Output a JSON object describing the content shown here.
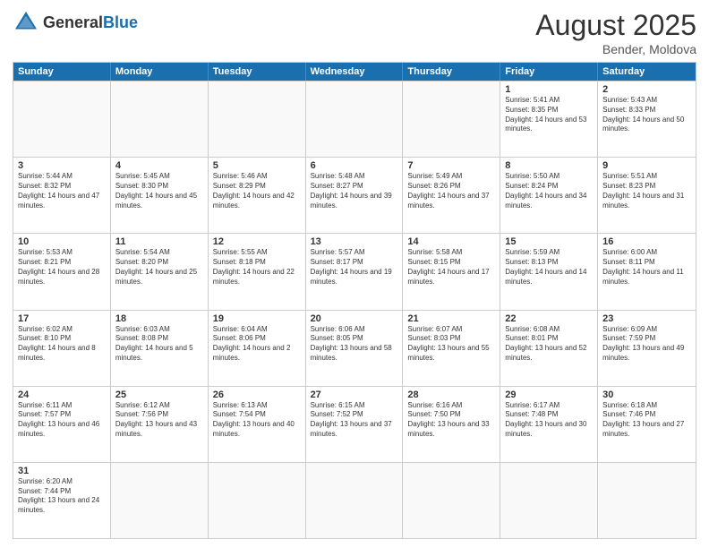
{
  "header": {
    "logo_general": "General",
    "logo_blue": "Blue",
    "month_title": "August 2025",
    "location": "Bender, Moldova"
  },
  "weekdays": [
    "Sunday",
    "Monday",
    "Tuesday",
    "Wednesday",
    "Thursday",
    "Friday",
    "Saturday"
  ],
  "rows": [
    [
      {
        "day": "",
        "info": ""
      },
      {
        "day": "",
        "info": ""
      },
      {
        "day": "",
        "info": ""
      },
      {
        "day": "",
        "info": ""
      },
      {
        "day": "",
        "info": ""
      },
      {
        "day": "1",
        "info": "Sunrise: 5:41 AM\nSunset: 8:35 PM\nDaylight: 14 hours and 53 minutes."
      },
      {
        "day": "2",
        "info": "Sunrise: 5:43 AM\nSunset: 8:33 PM\nDaylight: 14 hours and 50 minutes."
      }
    ],
    [
      {
        "day": "3",
        "info": "Sunrise: 5:44 AM\nSunset: 8:32 PM\nDaylight: 14 hours and 47 minutes."
      },
      {
        "day": "4",
        "info": "Sunrise: 5:45 AM\nSunset: 8:30 PM\nDaylight: 14 hours and 45 minutes."
      },
      {
        "day": "5",
        "info": "Sunrise: 5:46 AM\nSunset: 8:29 PM\nDaylight: 14 hours and 42 minutes."
      },
      {
        "day": "6",
        "info": "Sunrise: 5:48 AM\nSunset: 8:27 PM\nDaylight: 14 hours and 39 minutes."
      },
      {
        "day": "7",
        "info": "Sunrise: 5:49 AM\nSunset: 8:26 PM\nDaylight: 14 hours and 37 minutes."
      },
      {
        "day": "8",
        "info": "Sunrise: 5:50 AM\nSunset: 8:24 PM\nDaylight: 14 hours and 34 minutes."
      },
      {
        "day": "9",
        "info": "Sunrise: 5:51 AM\nSunset: 8:23 PM\nDaylight: 14 hours and 31 minutes."
      }
    ],
    [
      {
        "day": "10",
        "info": "Sunrise: 5:53 AM\nSunset: 8:21 PM\nDaylight: 14 hours and 28 minutes."
      },
      {
        "day": "11",
        "info": "Sunrise: 5:54 AM\nSunset: 8:20 PM\nDaylight: 14 hours and 25 minutes."
      },
      {
        "day": "12",
        "info": "Sunrise: 5:55 AM\nSunset: 8:18 PM\nDaylight: 14 hours and 22 minutes."
      },
      {
        "day": "13",
        "info": "Sunrise: 5:57 AM\nSunset: 8:17 PM\nDaylight: 14 hours and 19 minutes."
      },
      {
        "day": "14",
        "info": "Sunrise: 5:58 AM\nSunset: 8:15 PM\nDaylight: 14 hours and 17 minutes."
      },
      {
        "day": "15",
        "info": "Sunrise: 5:59 AM\nSunset: 8:13 PM\nDaylight: 14 hours and 14 minutes."
      },
      {
        "day": "16",
        "info": "Sunrise: 6:00 AM\nSunset: 8:11 PM\nDaylight: 14 hours and 11 minutes."
      }
    ],
    [
      {
        "day": "17",
        "info": "Sunrise: 6:02 AM\nSunset: 8:10 PM\nDaylight: 14 hours and 8 minutes."
      },
      {
        "day": "18",
        "info": "Sunrise: 6:03 AM\nSunset: 8:08 PM\nDaylight: 14 hours and 5 minutes."
      },
      {
        "day": "19",
        "info": "Sunrise: 6:04 AM\nSunset: 8:06 PM\nDaylight: 14 hours and 2 minutes."
      },
      {
        "day": "20",
        "info": "Sunrise: 6:06 AM\nSunset: 8:05 PM\nDaylight: 13 hours and 58 minutes."
      },
      {
        "day": "21",
        "info": "Sunrise: 6:07 AM\nSunset: 8:03 PM\nDaylight: 13 hours and 55 minutes."
      },
      {
        "day": "22",
        "info": "Sunrise: 6:08 AM\nSunset: 8:01 PM\nDaylight: 13 hours and 52 minutes."
      },
      {
        "day": "23",
        "info": "Sunrise: 6:09 AM\nSunset: 7:59 PM\nDaylight: 13 hours and 49 minutes."
      }
    ],
    [
      {
        "day": "24",
        "info": "Sunrise: 6:11 AM\nSunset: 7:57 PM\nDaylight: 13 hours and 46 minutes."
      },
      {
        "day": "25",
        "info": "Sunrise: 6:12 AM\nSunset: 7:56 PM\nDaylight: 13 hours and 43 minutes."
      },
      {
        "day": "26",
        "info": "Sunrise: 6:13 AM\nSunset: 7:54 PM\nDaylight: 13 hours and 40 minutes."
      },
      {
        "day": "27",
        "info": "Sunrise: 6:15 AM\nSunset: 7:52 PM\nDaylight: 13 hours and 37 minutes."
      },
      {
        "day": "28",
        "info": "Sunrise: 6:16 AM\nSunset: 7:50 PM\nDaylight: 13 hours and 33 minutes."
      },
      {
        "day": "29",
        "info": "Sunrise: 6:17 AM\nSunset: 7:48 PM\nDaylight: 13 hours and 30 minutes."
      },
      {
        "day": "30",
        "info": "Sunrise: 6:18 AM\nSunset: 7:46 PM\nDaylight: 13 hours and 27 minutes."
      }
    ],
    [
      {
        "day": "31",
        "info": "Sunrise: 6:20 AM\nSunset: 7:44 PM\nDaylight: 13 hours and 24 minutes."
      },
      {
        "day": "",
        "info": ""
      },
      {
        "day": "",
        "info": ""
      },
      {
        "day": "",
        "info": ""
      },
      {
        "day": "",
        "info": ""
      },
      {
        "day": "",
        "info": ""
      },
      {
        "day": "",
        "info": ""
      }
    ]
  ]
}
